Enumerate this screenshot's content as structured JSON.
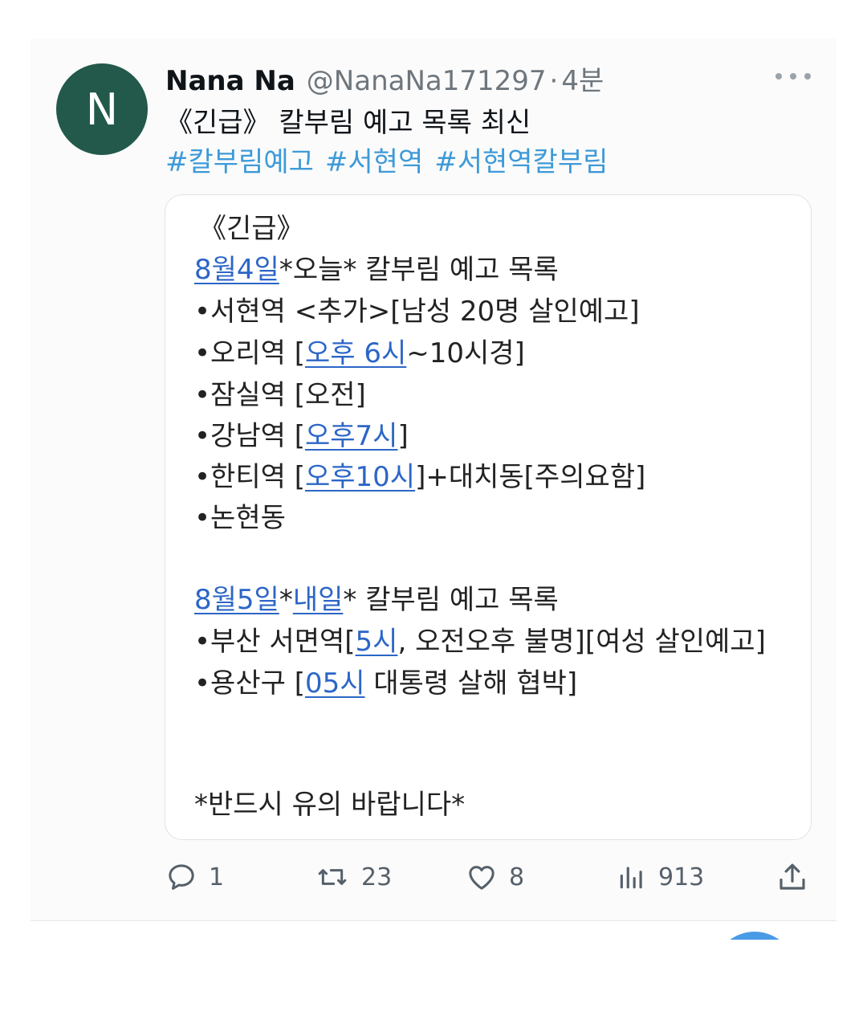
{
  "tweet": {
    "avatar_letter": "N",
    "display_name": "Nana Na",
    "handle": "@NanaNa171297",
    "separator": "·",
    "time": "4분",
    "text": "《긴급》 칼부림 예고 목록 최신",
    "hashtags": [
      "#칼부림예고",
      "#서현역",
      "#서현역칼부림"
    ]
  },
  "quote": {
    "header": "《긴급》",
    "today_date": "8월4일",
    "today_title": "*오늘* 칼부림 예고 목록",
    "line1": "•서현역 <추가>[남성 20명 살인예고]",
    "line2_prefix": "•오리역 [",
    "line2_link": "오후 6시",
    "line2_suffix": "~10시경]",
    "line3": "•잠실역 [오전]",
    "line4_prefix": "•강남역 [",
    "line4_link": "오후7시",
    "line4_suffix": "]",
    "line5_prefix": "•한티역 [",
    "line5_link": "오후10시",
    "line5_suffix": "]+대치동[주의요함]",
    "line6": "•논현동",
    "tomorrow_date": "8월5일",
    "tomorrow_mid": "*",
    "tomorrow_link": "내일",
    "tomorrow_title": "* 칼부림 예고 목록",
    "line7_prefix": "•부산 서면역[",
    "line7_link": "5시",
    "line7_suffix": ", 오전오후 불명][여성 살인예고]",
    "line8_prefix": "•용산구 [",
    "line8_link": "05시",
    "line8_suffix": " 대통령 살해 협박]",
    "footer": "*반드시 유의 바랍니다*"
  },
  "actions": {
    "replies": "1",
    "retweets": "23",
    "likes": "8",
    "views": "913"
  },
  "colors": {
    "link": "#2c66c7",
    "hashtag": "#3e9ad8",
    "avatar": "#22594a",
    "secondary_text": "#6e767d"
  }
}
